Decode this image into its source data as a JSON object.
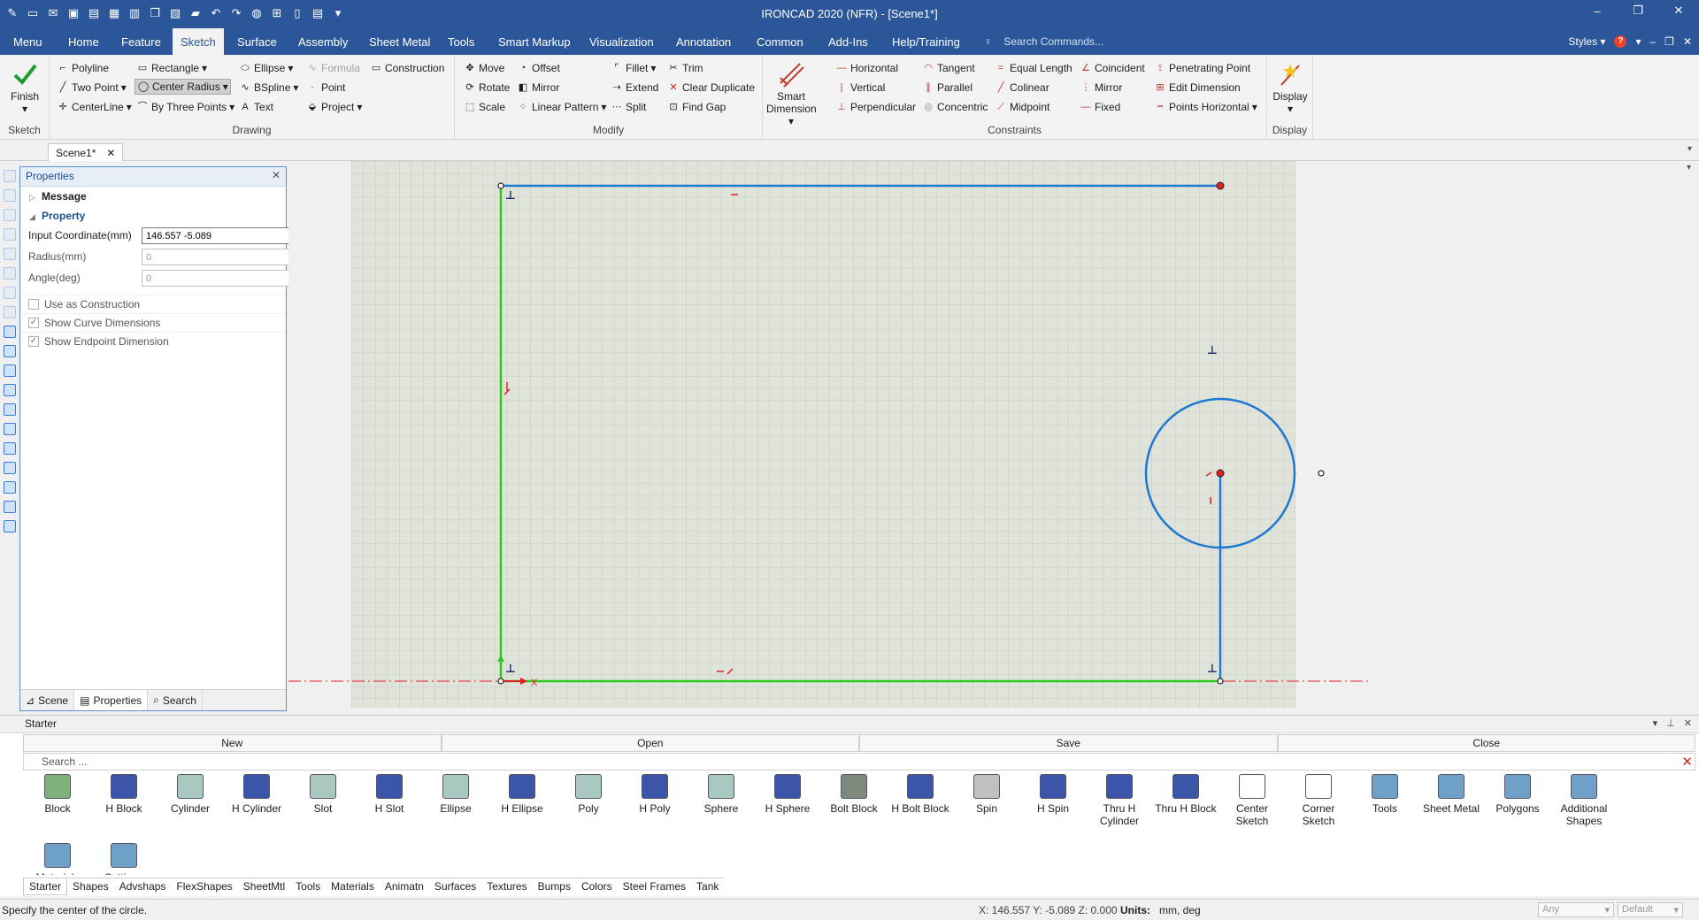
{
  "window": {
    "title": "IRONCAD 2020 (NFR) - [Scene1*]"
  },
  "menu": {
    "tabs": [
      "Menu",
      "Home",
      "Feature",
      "Sketch",
      "Surface",
      "Assembly",
      "Sheet Metal",
      "Tools",
      "Smart Markup",
      "Visualization",
      "Annotation",
      "Common",
      "Add-Ins",
      "Help/Training"
    ],
    "active": "Sketch",
    "search_placeholder": "Search Commands...",
    "styles_label": "Styles"
  },
  "ribbon": {
    "sketch_group": {
      "finish": "Finish",
      "label": "Sketch"
    },
    "drawing": {
      "label": "Drawing",
      "polyline": "Polyline",
      "two_point": "Two Point",
      "centerline": "CenterLine",
      "rectangle": "Rectangle",
      "center_radius": "Center Radius",
      "by_three_points": "By Three Points",
      "ellipse": "Ellipse",
      "bspline": "BSpline",
      "text": "Text",
      "formula": "Formula",
      "point": "Point",
      "project": "Project",
      "construction": "Construction"
    },
    "modify": {
      "label": "Modify",
      "move": "Move",
      "rotate": "Rotate",
      "scale": "Scale",
      "offset": "Offset",
      "mirror": "Mirror",
      "linear_pattern": "Linear Pattern",
      "fillet": "Fillet",
      "extend": "Extend",
      "split": "Split",
      "trim": "Trim",
      "clear_duplicate": "Clear Duplicate",
      "find_gap": "Find Gap"
    },
    "constraints": {
      "label": "Constraints",
      "smart_dimension": "Smart Dimension",
      "horizontal": "Horizontal",
      "vertical": "Vertical",
      "perpendicular": "Perpendicular",
      "tangent": "Tangent",
      "parallel": "Parallel",
      "concentric": "Concentric",
      "equal_length": "Equal Length",
      "colinear": "Colinear",
      "midpoint": "Midpoint",
      "coincident": "Coincident",
      "mirror": "Mirror",
      "fixed": "Fixed",
      "penetrating_point": "Penetrating Point",
      "edit_dimension": "Edit Dimension",
      "points_horizontal": "Points Horizontal"
    },
    "display": {
      "button": "Display",
      "label": "Display"
    }
  },
  "doc_tab": "Scene1*",
  "properties": {
    "title": "Properties",
    "message_section": "Message",
    "property_section": "Property",
    "input_coordinate_label": "Input Coordinate(mm)",
    "input_coordinate_value": "146.557 -5.089",
    "radius_label": "Radius(mm)",
    "radius_value": "0",
    "angle_label": "Angle(deg)",
    "angle_value": "0",
    "use_as_construction": "Use as Construction",
    "show_curve_dimensions": "Show Curve Dimensions",
    "show_endpoint_dimension": "Show Endpoint Dimension",
    "footer_tabs": [
      "Scene",
      "Properties",
      "Search"
    ]
  },
  "catalog": {
    "title": "Starter",
    "buttons": [
      "New",
      "Open",
      "Save",
      "Close"
    ],
    "search_placeholder": "Search ...",
    "shapes": [
      "Block",
      "H Block",
      "Cylinder",
      "H Cylinder",
      "Slot",
      "H Slot",
      "Ellipse",
      "H Ellipse",
      "Poly",
      "H Poly",
      "Sphere",
      "H Sphere",
      "Bolt Block",
      "H Bolt Block",
      "Spin",
      "H Spin",
      "Thru H Cylinder",
      "Thru H Block",
      "Center Sketch",
      "Corner Sketch",
      "Tools",
      "Sheet Metal",
      "Polygons",
      "Additional Shapes",
      "Materials",
      "Settings"
    ],
    "tabs": [
      "Starter",
      "Shapes",
      "Advshaps",
      "FlexShapes",
      "SheetMtl",
      "Tools",
      "Materials",
      "Animatn",
      "Surfaces",
      "Textures",
      "Bumps",
      "Colors",
      "Steel Frames",
      "Tank"
    ]
  },
  "status": {
    "message": "Specify the center of the circle.",
    "coords": "X: 146.557 Y: -5.089 Z: 0.000",
    "units_label": "Units:",
    "units_value": "mm, deg",
    "select1": "Any",
    "select2": "Default"
  },
  "colors": {
    "brand_blue": "#2b579a",
    "sketch_blue": "#1f78d1",
    "sketch_green": "#2ecc1a",
    "constraint_red": "#e02020",
    "grid_bg": "#dfe3da"
  }
}
